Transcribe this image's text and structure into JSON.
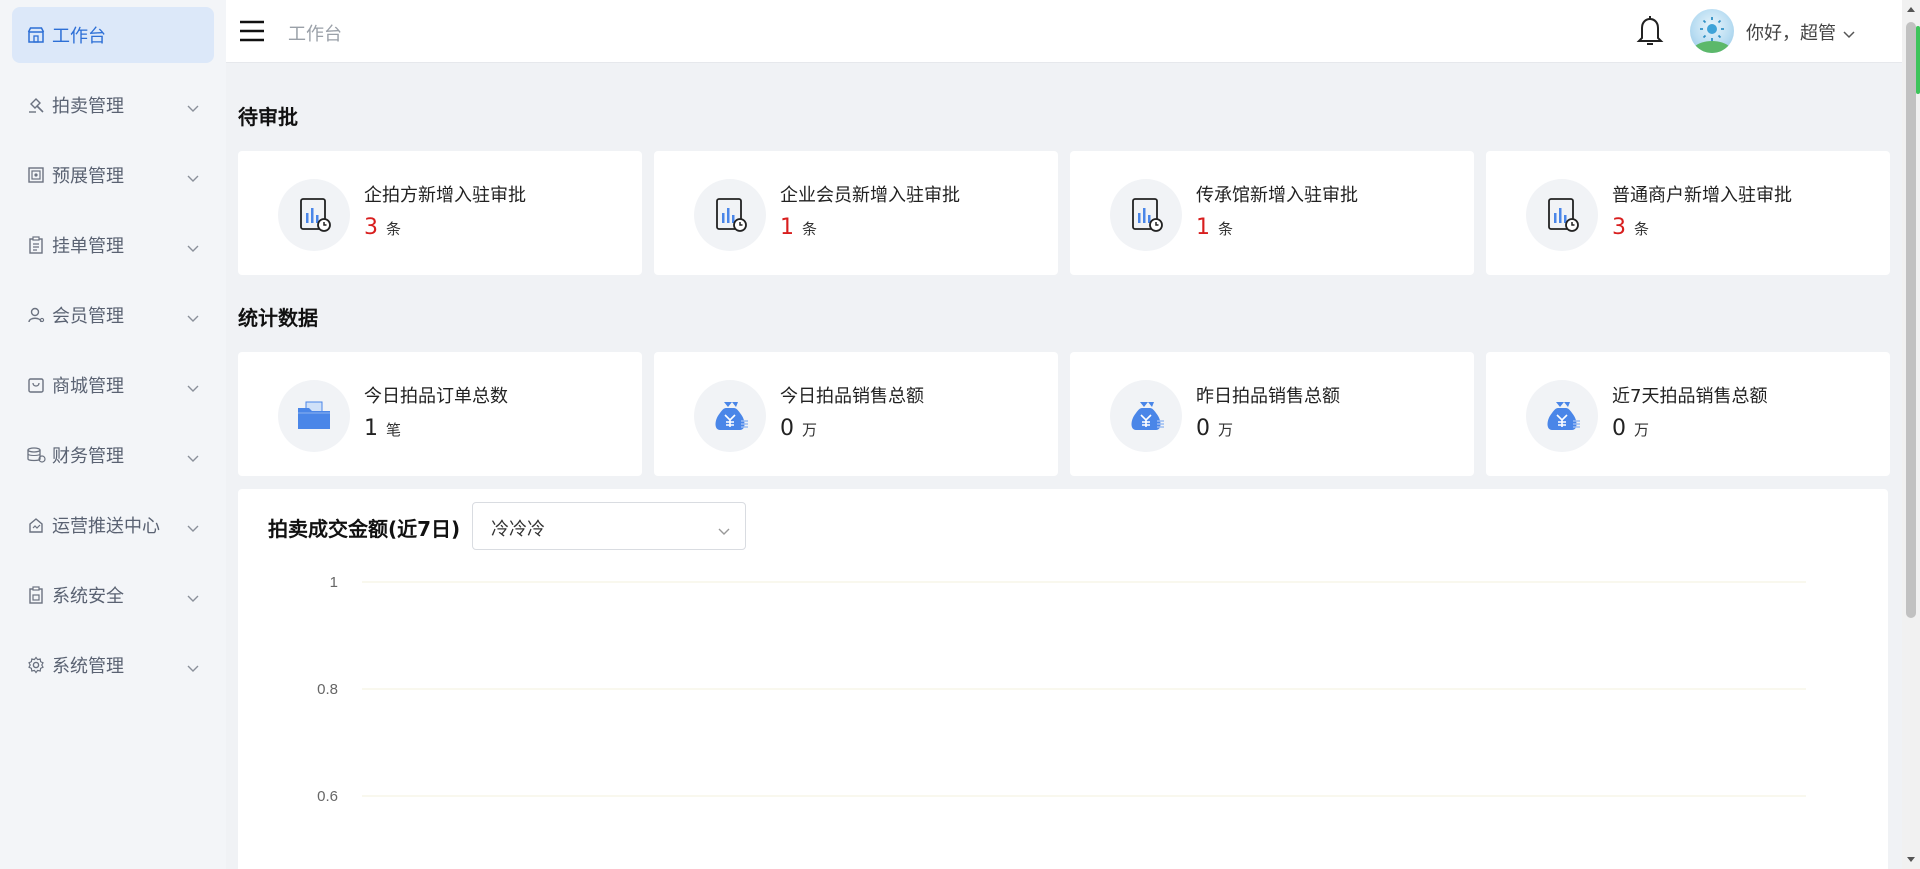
{
  "sidebar": {
    "items": [
      {
        "label": "工作台",
        "icon": "store-icon",
        "active": true
      },
      {
        "label": "拍卖管理",
        "icon": "gavel-icon"
      },
      {
        "label": "预展管理",
        "icon": "picture-icon"
      },
      {
        "label": "挂单管理",
        "icon": "clipboard-icon"
      },
      {
        "label": "会员管理",
        "icon": "user-icon"
      },
      {
        "label": "商城管理",
        "icon": "mall-icon"
      },
      {
        "label": "财务管理",
        "icon": "coins-icon"
      },
      {
        "label": "运营推送中心",
        "icon": "push-icon"
      },
      {
        "label": "系统安全",
        "icon": "security-icon"
      },
      {
        "label": "系统管理",
        "icon": "gear-icon"
      }
    ]
  },
  "header": {
    "breadcrumb": "工作台",
    "greeting": "你好，超管"
  },
  "pending": {
    "title": "待审批",
    "cards": [
      {
        "label": "企拍方新增入驻审批",
        "value": "3",
        "unit": "条"
      },
      {
        "label": "企业会员新增入驻审批",
        "value": "1",
        "unit": "条"
      },
      {
        "label": "传承馆新增入驻审批",
        "value": "1",
        "unit": "条"
      },
      {
        "label": "普通商户新增入驻审批",
        "value": "3",
        "unit": "条"
      }
    ]
  },
  "stats": {
    "title": "统计数据",
    "cards": [
      {
        "label": "今日拍品订单总数",
        "value": "1",
        "unit": "笔"
      },
      {
        "label": "今日拍品销售总额",
        "value": "0",
        "unit": "万"
      },
      {
        "label": "昨日拍品销售总额",
        "value": "0",
        "unit": "万"
      },
      {
        "label": "近7天拍品销售总额",
        "value": "0",
        "unit": "万"
      }
    ]
  },
  "chart": {
    "title": "拍卖成交金额(近7日)",
    "select_value": "冷冷冷"
  },
  "chart_data": {
    "type": "line",
    "title": "拍卖成交金额(近7日)",
    "y_ticks": [
      "1",
      "0.8",
      "0.6"
    ],
    "y_tick_values": [
      1,
      0.8,
      0.6
    ],
    "grid": true,
    "series": []
  },
  "colors": {
    "accent": "#2d6fd6",
    "highlight_number": "#d81e1e",
    "icon_blue": "#4a86e8"
  }
}
